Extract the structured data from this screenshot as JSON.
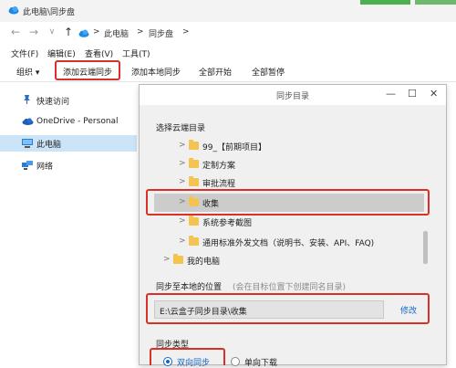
{
  "window": {
    "title": "此电脑\\同步盘"
  },
  "address": {
    "segments": [
      "此电脑",
      "同步盘"
    ],
    "separators": [
      ">",
      ">",
      ">"
    ]
  },
  "menu": [
    "文件(F)",
    "编辑(E)",
    "查看(V)",
    "工具(T)"
  ],
  "toolbar": {
    "organize": "组织 ▾",
    "add_cloud_sync": "添加云端同步",
    "add_local_sync": "添加本地同步",
    "start_all": "全部开始",
    "pause_all": "全部暂停"
  },
  "sidebar": {
    "items": [
      {
        "label": "快速访问",
        "icon": "pin-icon"
      },
      {
        "label": "OneDrive - Personal",
        "icon": "cloud-icon"
      },
      {
        "label": "此电脑",
        "icon": "computer-icon"
      },
      {
        "label": "网络",
        "icon": "network-icon"
      }
    ]
  },
  "dialog": {
    "title": "同步目录",
    "minimize": "—",
    "maximize": "☐",
    "close": "✕",
    "section_cloud": "选择云端目录",
    "tree": [
      {
        "label": "99_【前期项目】",
        "chevron": ">"
      },
      {
        "label": "定制方案",
        "chevron": ">"
      },
      {
        "label": "审批流程",
        "chevron": ">"
      },
      {
        "label": "收集",
        "chevron": ">",
        "selected": true
      },
      {
        "label": "系统参考截图",
        "chevron": ">"
      },
      {
        "label": "通用标准外发文档（说明书、安装、API、FAQ)",
        "chevron": ">"
      },
      {
        "label": "我的电脑",
        "chevron": ">"
      }
    ],
    "section_local": "同步至本地的位置",
    "section_local_hint": "(会在目标位置下创建同名目录)",
    "local_path": "E:\\云盒子同步目录\\收集",
    "modify": "修改",
    "section_type": "同步类型",
    "option_two_way": "双向同步",
    "option_one_way": "单向下载"
  },
  "colors": {
    "highlight": "#d9302a",
    "link": "#1565c0",
    "folder": "#f5c350"
  }
}
